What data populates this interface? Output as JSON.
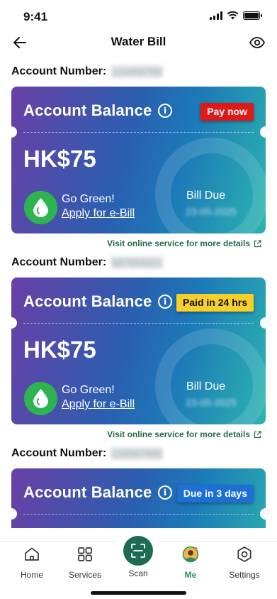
{
  "status_bar": {
    "time": "9:41"
  },
  "header": {
    "title": "Water Bill",
    "back_icon": "arrow-left-icon",
    "eye_icon": "eye-icon"
  },
  "accounts": [
    {
      "label": "Account Number:",
      "number": "123456789",
      "card": {
        "title": "Account Balance",
        "badge": "Pay now",
        "badge_color": "#e21717",
        "amount": "HK$75",
        "go_green": "Go Green!",
        "apply": "Apply for e-Bill",
        "bill_due_label": "Bill Due",
        "bill_due_date": "23-05-2025"
      },
      "visit_link": "Visit online service for more details"
    },
    {
      "label": "Account Number:",
      "number": "987654321",
      "card": {
        "title": "Account Balance",
        "badge": "Paid in 24 hrs",
        "badge_color": "#f7cf2b",
        "amount": "HK$75",
        "go_green": "Go Green!",
        "apply": "Apply for e-Bill",
        "bill_due_label": "Bill Due",
        "bill_due_date": "23-05-2025"
      },
      "visit_link": "Visit online service for more details"
    },
    {
      "label": "Account Number:",
      "number": "234567890",
      "card": {
        "title": "Account Balance",
        "badge": "Due in 3 days",
        "badge_color": "#1d6fd6"
      }
    }
  ],
  "nav": {
    "home": "Home",
    "services": "Services",
    "scan": "Scan",
    "me": "Me",
    "settings": "Settings",
    "active": "Me"
  },
  "colors": {
    "accent": "#1c6b52",
    "link": "#246b4a"
  }
}
